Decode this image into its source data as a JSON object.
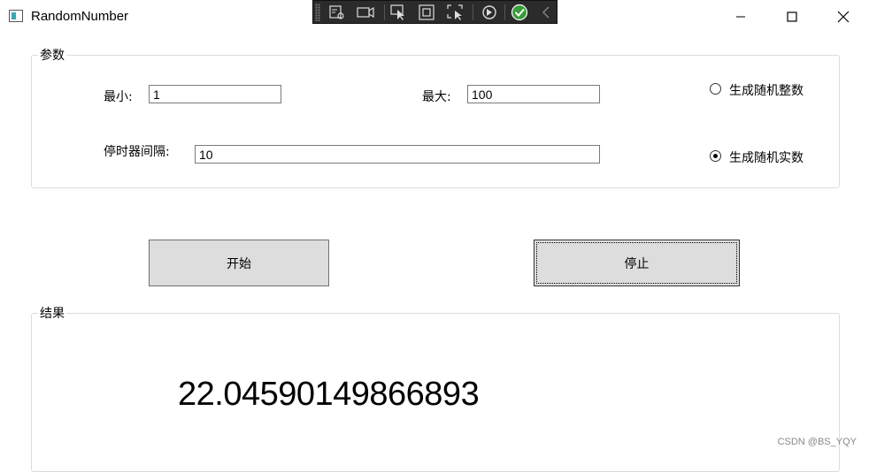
{
  "window": {
    "title": "RandomNumber",
    "controls": {
      "minimize": "—",
      "maximize": "☐",
      "close": "✕"
    }
  },
  "params": {
    "legend": "参数",
    "min_label": "最小:",
    "min_value": "1",
    "max_label": "最大:",
    "max_value": "100",
    "timer_label": "停时器间隔:",
    "timer_value": "10",
    "radio_int": "生成随机整数",
    "radio_real": "生成随机实数",
    "selected": "real"
  },
  "buttons": {
    "start": "开始",
    "stop": "停止"
  },
  "result": {
    "legend": "结果",
    "value": "22.04590149866893"
  },
  "watermark": "CSDN @BS_YQY"
}
